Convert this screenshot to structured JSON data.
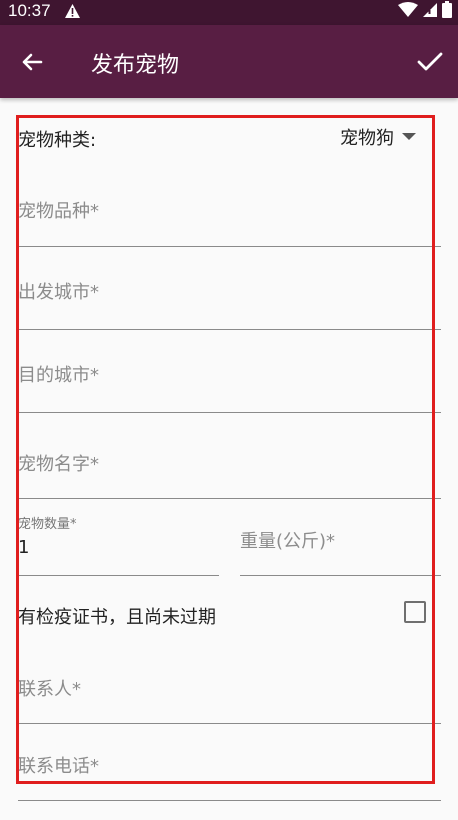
{
  "status_bar": {
    "time": "10:37",
    "alert_icon": "!"
  },
  "app_bar": {
    "title": "发布宠物"
  },
  "form": {
    "pet_type_label": "宠物种类:",
    "pet_type_value": "宠物狗",
    "breed_hint": "宠物品种*",
    "from_city_hint": "出发城市*",
    "to_city_hint": "目的城市*",
    "pet_name_hint": "宠物名字*",
    "quantity_label": "宠物数量*",
    "quantity_value": "1",
    "weight_hint": "重量(公斤)*",
    "quarantine_label": "有检疫证书，且尚未过期",
    "quarantine_checked": false,
    "contact_name_hint": "联系人*",
    "contact_phone_hint": "联系电话*"
  },
  "colors": {
    "status_bar": "#3f1530",
    "app_bar": "#581e43",
    "highlight": "#e01e1e"
  }
}
